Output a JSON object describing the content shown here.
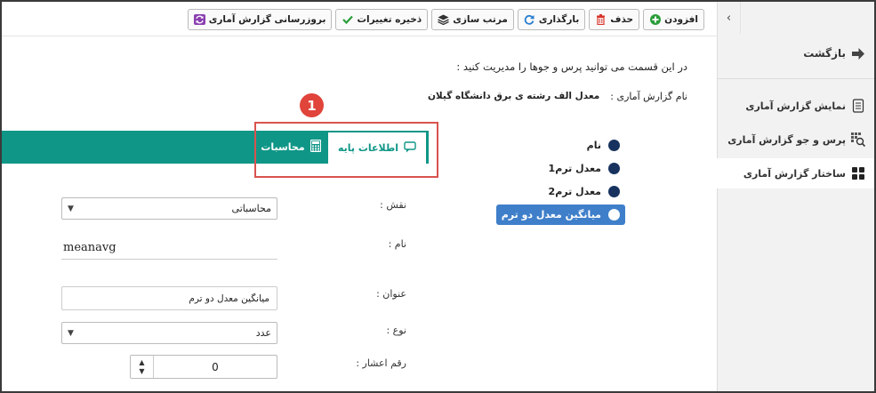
{
  "toolbar": {
    "add": "افزودن",
    "delete": "حذف",
    "reload": "بارگذاری",
    "sort": "مرتب سازی",
    "save": "ذخیره تغییرات",
    "update_report": "بروزرسانی گزارش آماری"
  },
  "sidebar": {
    "collapse": "‹",
    "back": "بازگشت",
    "items": [
      {
        "label": "نمایش گزارش آماری"
      },
      {
        "label": "پرس و جو گزارش آماری"
      },
      {
        "label": "ساختار گزارش آماری"
      }
    ]
  },
  "main": {
    "intro": "در این قسمت می توانید پرس و جوها را مدیریت کنید :",
    "report_name_label": "نام گزارش آماری :",
    "report_name_value": "معدل الف رشته ی برق دانشگاه گیلان",
    "badge": "1",
    "tabs": [
      {
        "label": "اطلاعات پایه"
      },
      {
        "label": "محاسبات"
      }
    ],
    "tree": [
      {
        "label": "نام"
      },
      {
        "label": "معدل ترم1"
      },
      {
        "label": "معدل ترم2"
      },
      {
        "label": "میانگین معدل دو ترم"
      }
    ]
  },
  "form": {
    "role_label": "نقش :",
    "role_value": "محاسباتی",
    "name_label": "نام :",
    "name_value": "meanavg",
    "title_label": "عنوان :",
    "title_value": "میانگین معدل دو ترم",
    "type_label": "نوع :",
    "type_value": "عدد",
    "decimals_label": "رقم اعشار :",
    "decimals_value": "0"
  },
  "colors": {
    "accent": "#0f9687",
    "selected": "#3f7fca",
    "dot": "#17325e",
    "highlight": "#d9534f"
  }
}
